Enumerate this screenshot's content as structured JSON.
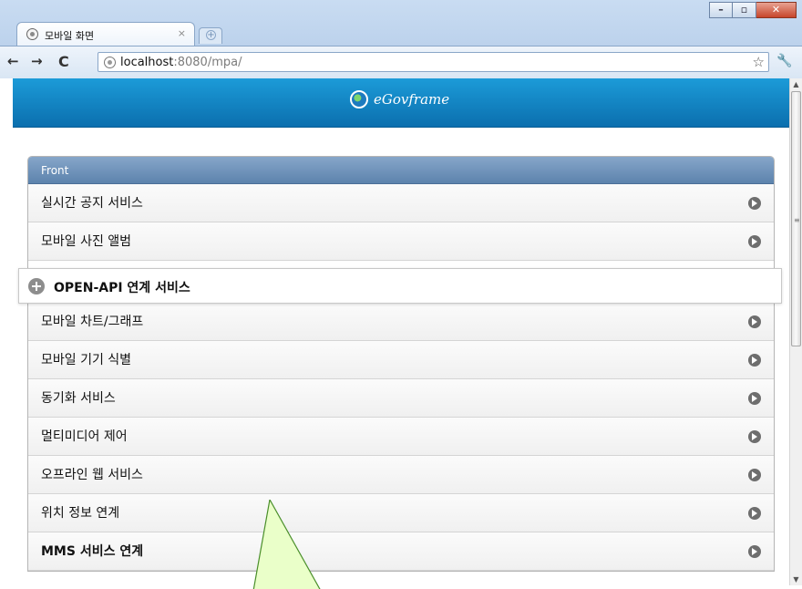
{
  "browser": {
    "tab_title": "모바일 화면",
    "tab_close": "×",
    "url_host": "localhost",
    "url_rest": ":8080/mpa/",
    "icons": [
      "back-arrow-icon",
      "forward-arrow-icon",
      "reload-icon",
      "star-icon",
      "wrench-icon"
    ]
  },
  "header": {
    "logo_text": "eGovframe"
  },
  "list": {
    "divider": "Front",
    "items": [
      "실시간 공지 서비스",
      "모바일 사진 앨범",
      "모바일 차트/그래프",
      "모바일 기기 식별",
      "동기화 서비스",
      "멀티미디어 제어",
      "오프라인 웹 서비스",
      "위치 정보 연계",
      "MMS 서비스 연계"
    ],
    "floating_item": "OPEN-API 연계 서비스"
  },
  "colors": {
    "header_top": "#1c9bd8",
    "header_bottom": "#0b6fae",
    "divider": "#6f93bc",
    "callout_fill": "#eaffc9",
    "callout_stroke": "#4a8f2a"
  }
}
